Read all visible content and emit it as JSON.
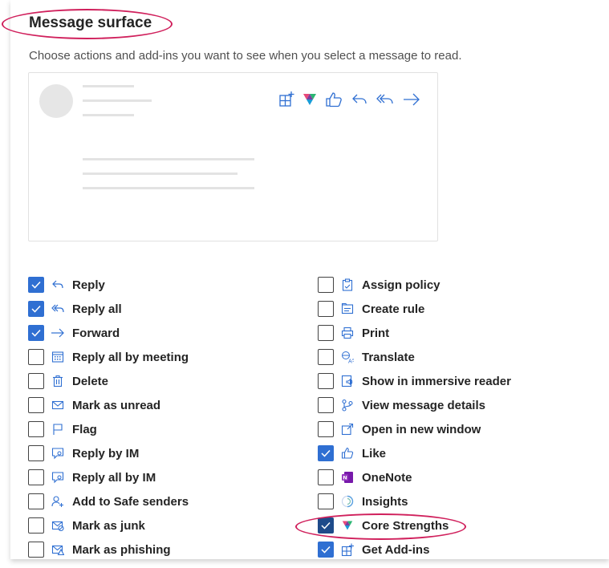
{
  "section": {
    "title": "Message surface",
    "description": "Choose actions and add-ins you want to see when you select a message to read."
  },
  "preview": {
    "toolbar_icons": [
      "get-add-ins-icon",
      "core-strengths-icon",
      "like-icon",
      "reply-icon",
      "reply-all-icon",
      "forward-icon"
    ]
  },
  "options_left": [
    {
      "label": "Reply",
      "checked": true,
      "icon": "reply-icon"
    },
    {
      "label": "Reply all",
      "checked": true,
      "icon": "reply-all-icon"
    },
    {
      "label": "Forward",
      "checked": true,
      "icon": "forward-icon"
    },
    {
      "label": "Reply all by meeting",
      "checked": false,
      "icon": "calendar-icon"
    },
    {
      "label": "Delete",
      "checked": false,
      "icon": "trash-icon"
    },
    {
      "label": "Mark as unread",
      "checked": false,
      "icon": "envelope-icon"
    },
    {
      "label": "Flag",
      "checked": false,
      "icon": "flag-icon"
    },
    {
      "label": "Reply by IM",
      "checked": false,
      "icon": "chat-icon"
    },
    {
      "label": "Reply all by IM",
      "checked": false,
      "icon": "chat-icon"
    },
    {
      "label": "Add to Safe senders",
      "checked": false,
      "icon": "person-add-icon"
    },
    {
      "label": "Mark as junk",
      "checked": false,
      "icon": "junk-icon"
    },
    {
      "label": "Mark as phishing",
      "checked": false,
      "icon": "phishing-icon"
    }
  ],
  "options_right": [
    {
      "label": "Assign policy",
      "checked": false,
      "icon": "clipboard-icon"
    },
    {
      "label": "Create rule",
      "checked": false,
      "icon": "rule-icon"
    },
    {
      "label": "Print",
      "checked": false,
      "icon": "printer-icon"
    },
    {
      "label": "Translate",
      "checked": false,
      "icon": "translate-icon"
    },
    {
      "label": "Show in immersive reader",
      "checked": false,
      "icon": "immersive-reader-icon"
    },
    {
      "label": "View message details",
      "checked": false,
      "icon": "details-icon"
    },
    {
      "label": "Open in new window",
      "checked": false,
      "icon": "new-window-icon"
    },
    {
      "label": "Like",
      "checked": true,
      "icon": "like-icon"
    },
    {
      "label": "OneNote",
      "checked": false,
      "icon": "onenote-icon"
    },
    {
      "label": "Insights",
      "checked": false,
      "icon": "insights-icon"
    },
    {
      "label": "Core Strengths",
      "checked": true,
      "icon": "core-strengths-icon"
    },
    {
      "label": "Get Add-ins",
      "checked": true,
      "icon": "get-add-ins-icon"
    }
  ],
  "colors": {
    "accent": "#2f6fd2",
    "icon": "#2f6fd2",
    "highlight": "#d0205c"
  }
}
